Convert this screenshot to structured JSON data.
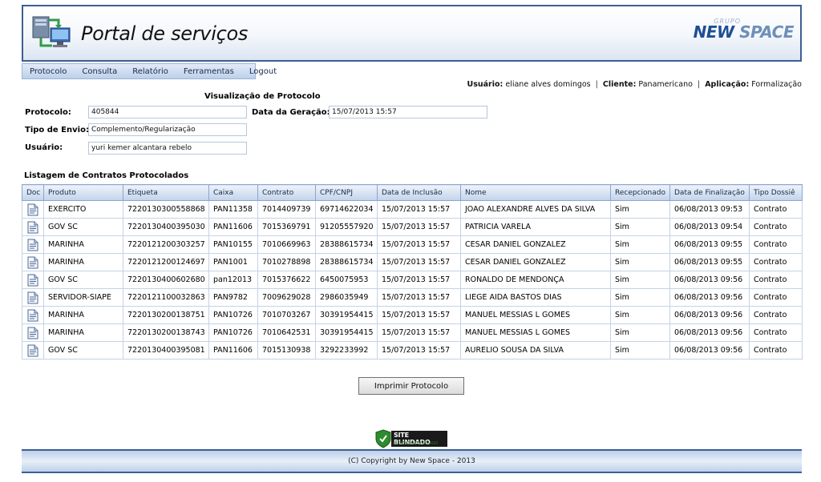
{
  "header": {
    "title": "Portal de serviços",
    "brand_top": "GRUPO",
    "brand_new": "NEW",
    "brand_space": "SPACE"
  },
  "nav": {
    "items": [
      "Protocolo",
      "Consulta",
      "Relatório",
      "Ferramentas",
      "Logout"
    ]
  },
  "userline": {
    "usuario_label": "Usuário:",
    "usuario": "eliane alves domingos",
    "cliente_label": "Cliente:",
    "cliente": "Panamericano",
    "aplicacao_label": "Aplicação:",
    "aplicacao": "Formalização"
  },
  "form": {
    "title": "Visualização de Protocolo",
    "protocolo_label": "Protocolo:",
    "protocolo": "405844",
    "data_geracao_label": "Data da Geração:",
    "data_geracao": "15/07/2013 15:57",
    "tipo_envio_label": "Tipo de Envio:",
    "tipo_envio": "Complemento/Regularização",
    "usuario_label": "Usuário:",
    "usuario": "yuri kemer alcantara rebelo"
  },
  "list": {
    "title": "Listagem de Contratos Protocolados",
    "headers": [
      "Doc",
      "Produto",
      "Etiqueta",
      "Caixa",
      "Contrato",
      "CPF/CNPJ",
      "Data de Inclusão",
      "Nome",
      "Recepcionado",
      "Data de Finalização",
      "Tipo Dossiê"
    ],
    "rows": [
      [
        "EXERCITO",
        "7220130300558868",
        "PAN11358",
        "7014409739",
        "69714622034",
        "15/07/2013 15:57",
        "JOAO ALEXANDRE ALVES DA SILVA",
        "Sim",
        "06/08/2013 09:53",
        "Contrato"
      ],
      [
        "GOV SC",
        "7220130400395030",
        "PAN11606",
        "7015369791",
        "91205557920",
        "15/07/2013 15:57",
        "PATRICIA VARELA",
        "Sim",
        "06/08/2013 09:54",
        "Contrato"
      ],
      [
        "MARINHA",
        "7220121200303257",
        "PAN10155",
        "7010669963",
        "28388615734",
        "15/07/2013 15:57",
        "CESAR DANIEL GONZALEZ",
        "Sim",
        "06/08/2013 09:55",
        "Contrato"
      ],
      [
        "MARINHA",
        "7220121200124697",
        "PAN1001",
        "7010278898",
        "28388615734",
        "15/07/2013 15:57",
        "CESAR DANIEL GONZALEZ",
        "Sim",
        "06/08/2013 09:55",
        "Contrato"
      ],
      [
        "GOV SC",
        "7220130400602680",
        "pan12013",
        "7015376622",
        "6450075953",
        "15/07/2013 15:57",
        "RONALDO DE MENDONÇA",
        "Sim",
        "06/08/2013 09:56",
        "Contrato"
      ],
      [
        "SERVIDOR-SIAPE",
        "7220121100032863",
        "PAN9782",
        "7009629028",
        "2986035949",
        "15/07/2013 15:57",
        "LIEGE AIDA BASTOS DIAS",
        "Sim",
        "06/08/2013 09:56",
        "Contrato"
      ],
      [
        "MARINHA",
        "7220130200138751",
        "PAN10726",
        "7010703267",
        "30391954415",
        "15/07/2013 15:57",
        "MANUEL MESSIAS L GOMES",
        "Sim",
        "06/08/2013 09:56",
        "Contrato"
      ],
      [
        "MARINHA",
        "7220130200138743",
        "PAN10726",
        "7010642531",
        "30391954415",
        "15/07/2013 15:57",
        "MANUEL MESSIAS L GOMES",
        "Sim",
        "06/08/2013 09:56",
        "Contrato"
      ],
      [
        "GOV SC",
        "7220130400395081",
        "PAN11606",
        "7015130938",
        "3292233992",
        "15/07/2013 15:57",
        "AURELIO SOUSA DA SILVA",
        "Sim",
        "06/08/2013 09:56",
        "Contrato"
      ]
    ]
  },
  "actions": {
    "print_label": "Imprimir Protocolo"
  },
  "seal": {
    "text": "SITE BLINDADO",
    "sub": "AUDITADO EM 20-AGO"
  },
  "footer": {
    "copyright": "(C) Copyright by New Space - 2013"
  },
  "icons": {
    "logo": "computer-network-icon",
    "doc": "document-icon",
    "seal": "shield-icon"
  },
  "colors": {
    "border_blue": "#3d5f93",
    "brand_blue": "#1f4f93",
    "seal_green": "#2e8b2e"
  }
}
